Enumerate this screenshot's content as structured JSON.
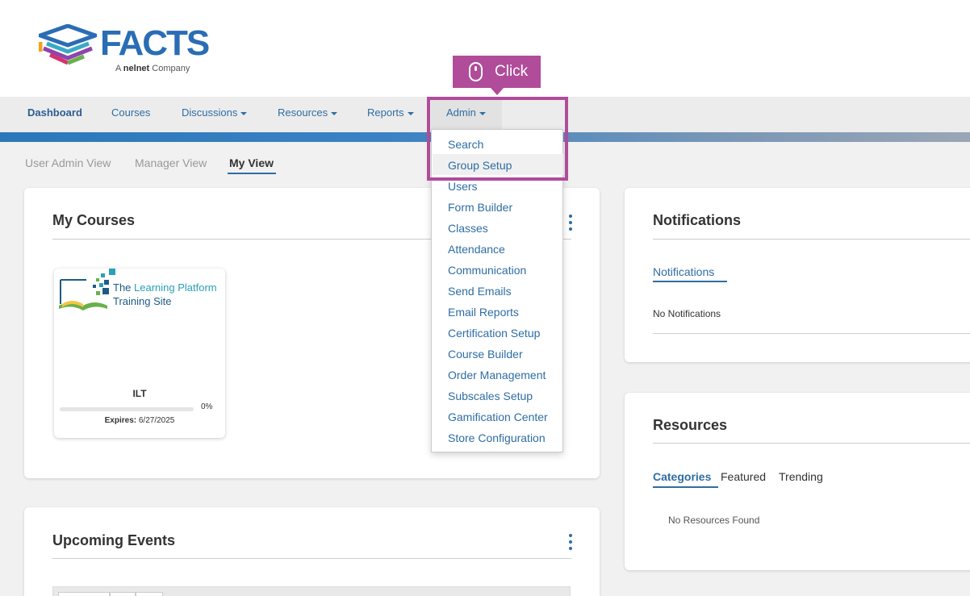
{
  "branding": {
    "logo_text": "FACTS",
    "logo_subtitle_prefix": "A",
    "logo_subtitle_brand": "nelnet",
    "logo_subtitle_suffix": "Company"
  },
  "nav": {
    "items": [
      {
        "label": "Dashboard",
        "active": true
      },
      {
        "label": "Courses"
      },
      {
        "label": "Discussions",
        "dropdown": true
      },
      {
        "label": "Resources",
        "dropdown": true
      },
      {
        "label": "Reports",
        "dropdown": true
      },
      {
        "label": "Admin",
        "dropdown": true,
        "open": true
      }
    ]
  },
  "views": {
    "tabs": [
      "User Admin View",
      "Manager View",
      "My View"
    ],
    "selected": "My View"
  },
  "my_courses": {
    "title": "My Courses",
    "course": {
      "name_prefix": "The ",
      "name_highlight": "Learning Platform",
      "name_line2": "Training Site",
      "type": "ILT",
      "progress": 0,
      "progress_label": "0%",
      "expires_label": "Expires:",
      "expires_date": "6/27/2025"
    }
  },
  "upcoming_events": {
    "title": "Upcoming Events"
  },
  "notifications": {
    "title": "Notifications",
    "tab": "Notifications",
    "empty": "No Notifications"
  },
  "resources": {
    "title": "Resources",
    "tabs": [
      "Categories",
      "Featured",
      "Trending"
    ],
    "selected": "Categories",
    "empty": "No Resources Found"
  },
  "admin_menu": {
    "items": [
      "Search",
      "Group Setup",
      "Users",
      "Form Builder",
      "Classes",
      "Attendance",
      "Communication",
      "Send Emails",
      "Email Reports",
      "Certification Setup",
      "Course Builder",
      "Order Management",
      "Subscales Setup",
      "Gamification Center",
      "Store Configuration"
    ],
    "hovered": "Group Setup"
  },
  "annotation": {
    "label": "Click",
    "color": "#b04c9a"
  },
  "colors": {
    "link": "#2e6da4",
    "brand": "#2a6db5"
  }
}
